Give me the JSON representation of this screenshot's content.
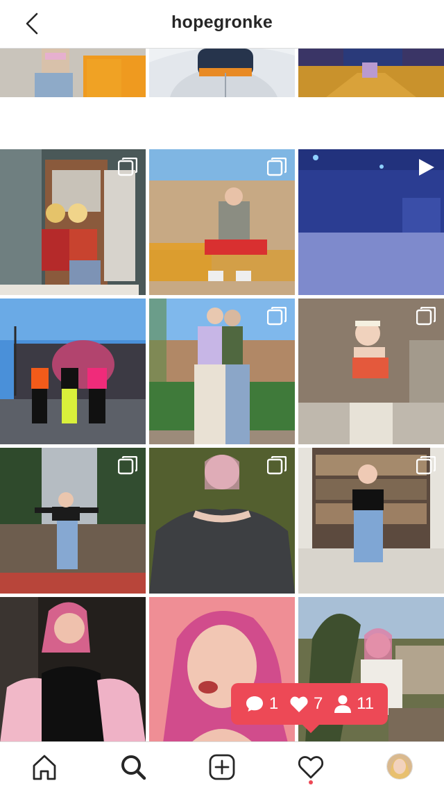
{
  "header": {
    "title": "hopegronke",
    "back_icon": "chevron-left-icon"
  },
  "grid": {
    "tiles": [
      {
        "id": "post-1",
        "kind": "photo",
        "icons": ""
      },
      {
        "id": "post-2",
        "kind": "photo",
        "icons": ""
      },
      {
        "id": "post-3",
        "kind": "photo",
        "icons": ""
      },
      {
        "id": "post-4",
        "kind": "carousel",
        "icons": "carousel-icon"
      },
      {
        "id": "post-5",
        "kind": "carousel",
        "icons": "carousel-icon"
      },
      {
        "id": "post-6",
        "kind": "video",
        "icons": "play-icon"
      },
      {
        "id": "post-7",
        "kind": "photo",
        "icons": ""
      },
      {
        "id": "post-8",
        "kind": "carousel",
        "icons": "carousel-icon"
      },
      {
        "id": "post-9",
        "kind": "carousel",
        "icons": "carousel-icon"
      },
      {
        "id": "post-10",
        "kind": "carousel",
        "icons": "carousel-icon"
      },
      {
        "id": "post-11",
        "kind": "carousel",
        "icons": "carousel-icon"
      },
      {
        "id": "post-12",
        "kind": "carousel",
        "icons": "carousel-icon"
      },
      {
        "id": "post-13",
        "kind": "photo",
        "icons": ""
      },
      {
        "id": "post-14",
        "kind": "photo",
        "icons": ""
      },
      {
        "id": "post-15",
        "kind": "photo",
        "icons": ""
      }
    ]
  },
  "activity": {
    "comments": "1",
    "likes": "7",
    "follows": "11",
    "color": "#ed4956"
  },
  "bottom_nav": {
    "items": [
      "home-icon",
      "search-icon",
      "new-post-icon",
      "activity-heart-icon",
      "profile-avatar"
    ],
    "active": "search-icon",
    "notification_dot_color": "#ed4956"
  }
}
